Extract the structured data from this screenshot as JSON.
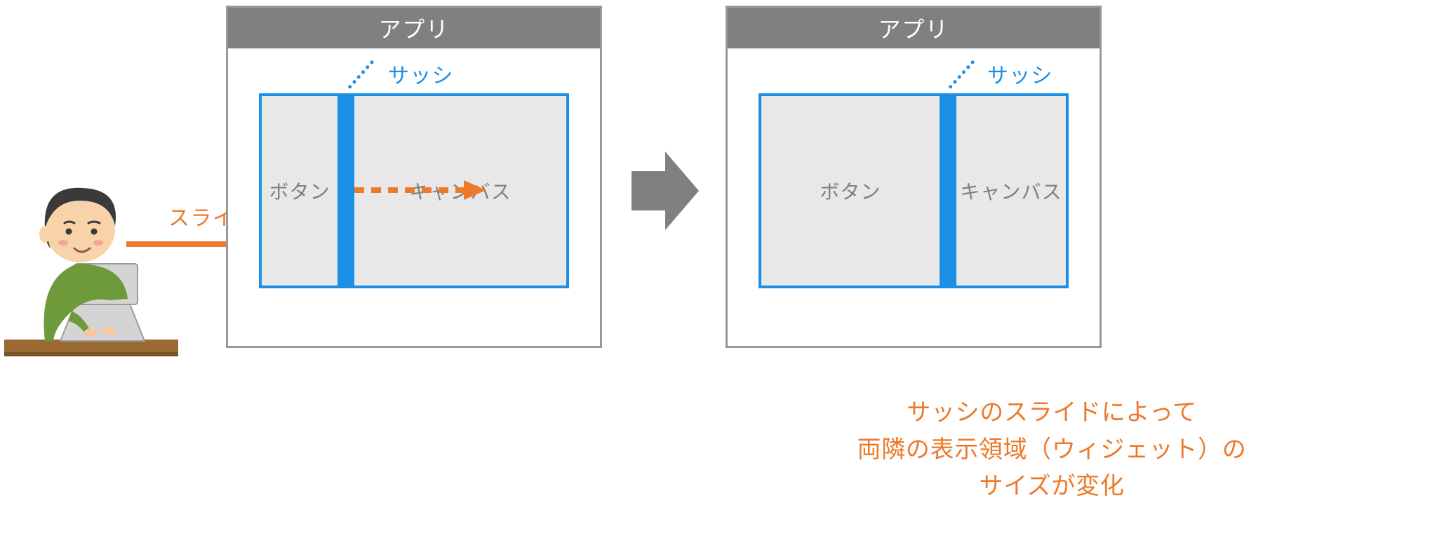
{
  "colors": {
    "gray_dark": "#808080",
    "gray_border": "#989898",
    "gray_fill": "#e8e8e8",
    "blue": "#1b8fe6",
    "blue_light": "#8cc2ec",
    "orange": "#ec7a2a"
  },
  "before": {
    "title": "アプリ",
    "pane_left": "ボタン",
    "pane_right": "キャンバス",
    "sash_label": "サッシ"
  },
  "after": {
    "title": "アプリ",
    "pane_left": "ボタン",
    "pane_right": "キャンバス",
    "sash_label": "サッシ"
  },
  "slide_label": "スライド",
  "annotation": {
    "line1": "サッシのスライドによって",
    "line2": "両隣の表示領域（ウィジェット）の",
    "line3": "サイズが変化"
  }
}
